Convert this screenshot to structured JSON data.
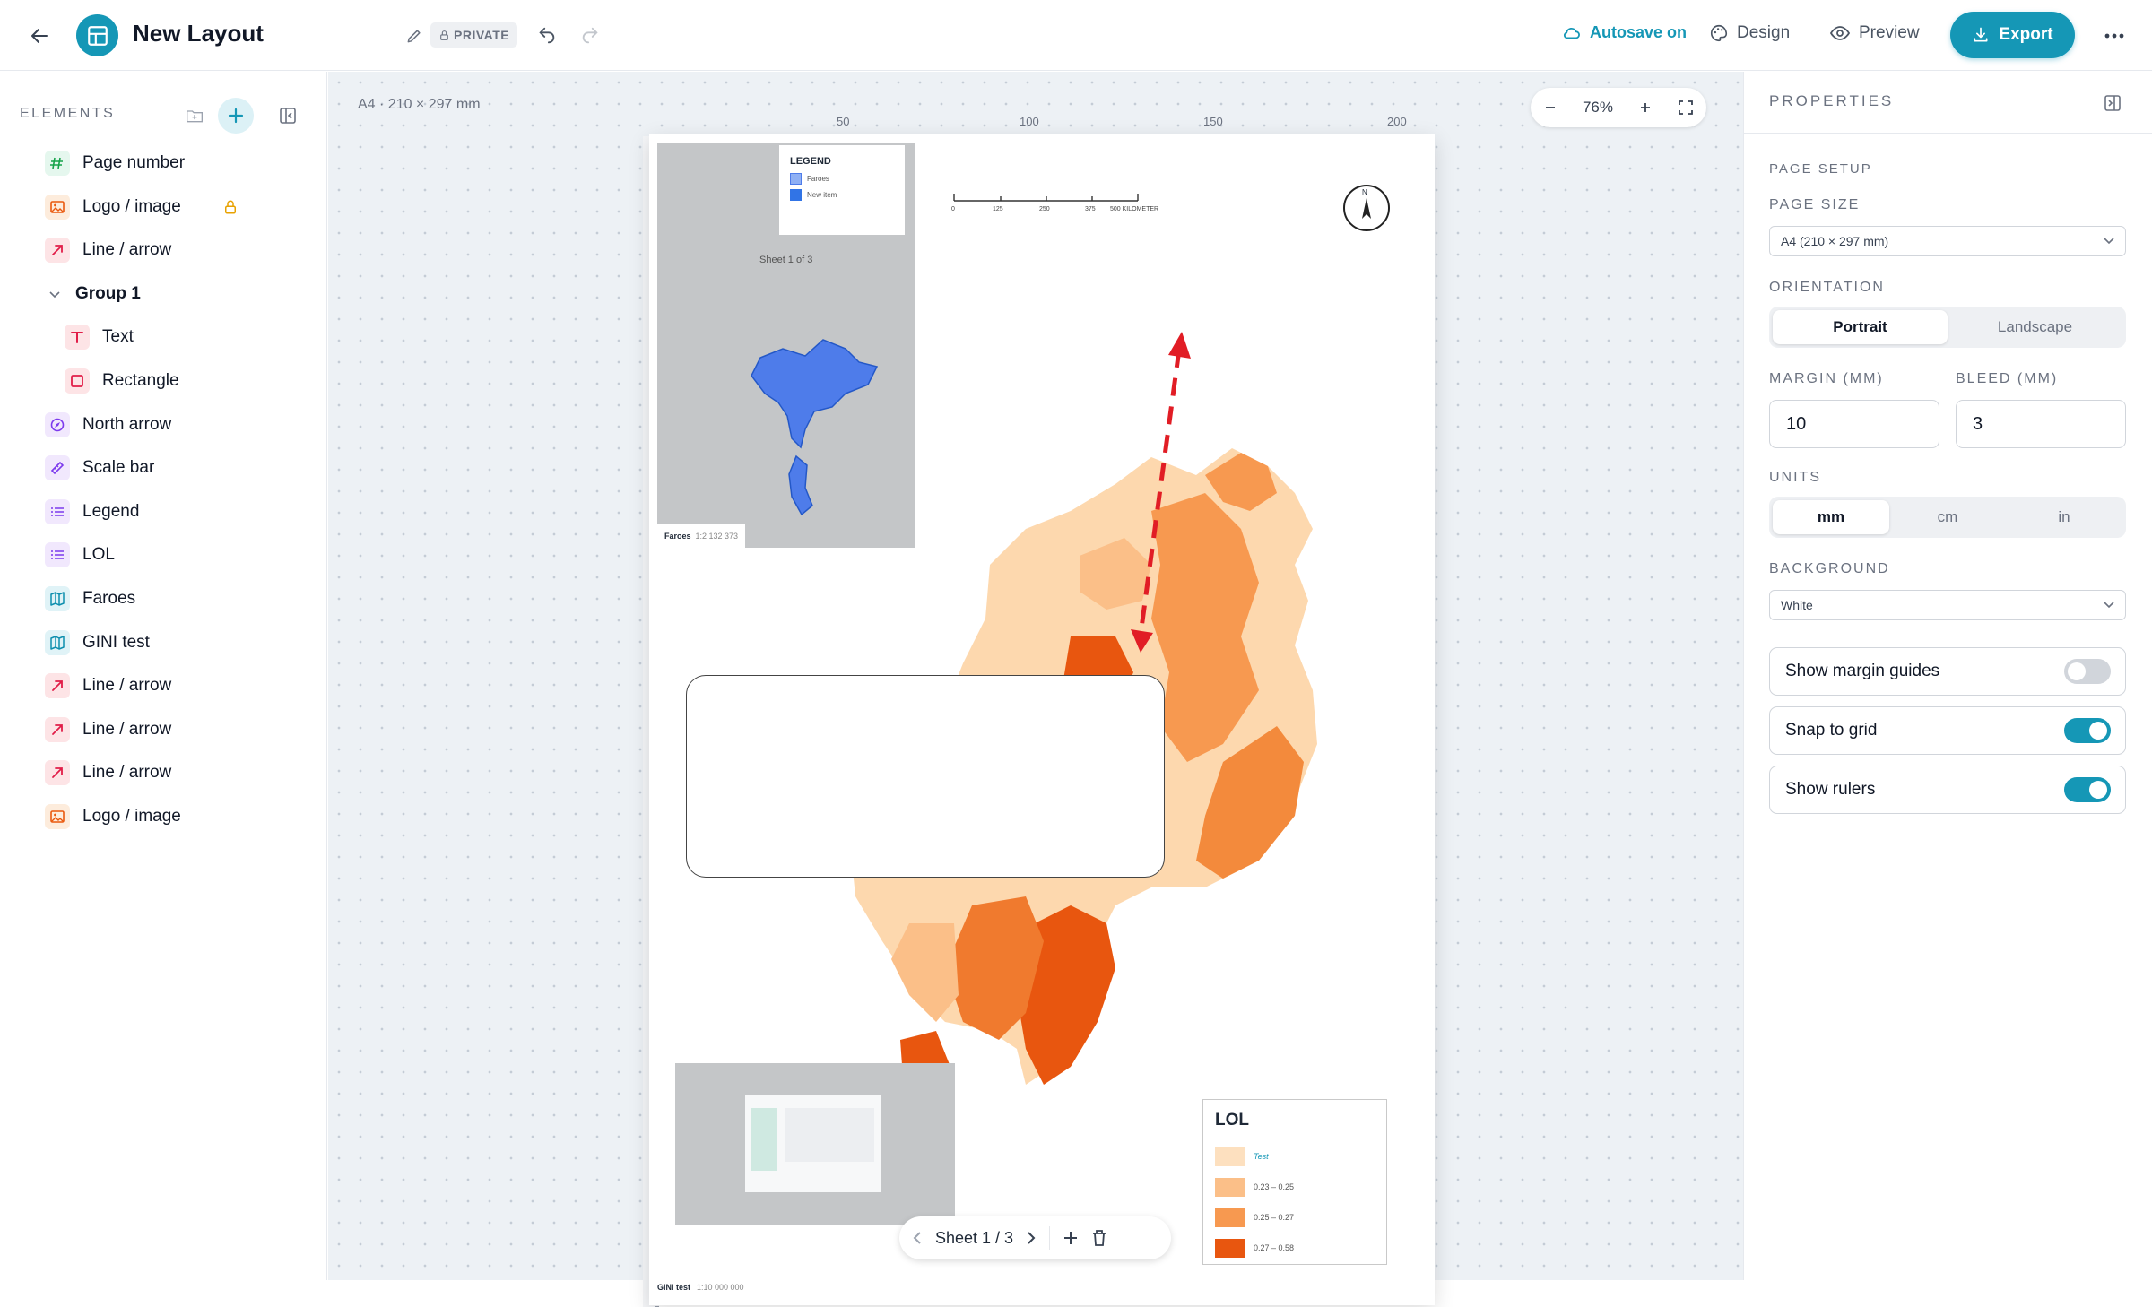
{
  "header": {
    "title": "New Layout",
    "private_label": "PRIVATE",
    "autosave_label": "Autosave on",
    "design_label": "Design",
    "preview_label": "Preview",
    "export_label": "Export",
    "accent": "#1597b6"
  },
  "sidebar": {
    "heading": "ELEMENTS",
    "items": [
      {
        "label": "Page number",
        "icon": "hash-icon"
      },
      {
        "label": "Logo / image",
        "icon": "image-icon",
        "locked": true
      },
      {
        "label": "Line / arrow",
        "icon": "arrow-icon"
      },
      {
        "label": "Group 1",
        "icon": "chevron-down-icon",
        "group": true
      },
      {
        "label": "Text",
        "icon": "text-icon",
        "child": true
      },
      {
        "label": "Rectangle",
        "icon": "square-icon",
        "child": true
      },
      {
        "label": "North arrow",
        "icon": "compass-icon"
      },
      {
        "label": "Scale bar",
        "icon": "ruler-icon"
      },
      {
        "label": "Legend",
        "icon": "list-icon"
      },
      {
        "label": "LOL",
        "icon": "list-icon"
      },
      {
        "label": "Faroes",
        "icon": "map-icon"
      },
      {
        "label": "GINI test",
        "icon": "map-icon"
      },
      {
        "label": "Line / arrow",
        "icon": "arrow-icon"
      },
      {
        "label": "Line / arrow",
        "icon": "arrow-icon"
      },
      {
        "label": "Line / arrow",
        "icon": "arrow-icon"
      },
      {
        "label": "Logo / image",
        "icon": "image-icon"
      }
    ]
  },
  "canvas": {
    "page_size_label": "A4 · 210 × 297 mm",
    "zoom": "76%",
    "ruler_labels": [
      "50",
      "100",
      "150",
      "200"
    ],
    "sheet_label": "Sheet 1 / 3"
  },
  "map_page": {
    "inset_legend_title": "LEGEND",
    "inset_legend_items": [
      "Faroes",
      "New item"
    ],
    "inset_sheet": "Sheet 1 of 3",
    "inset_caption": "Faroes",
    "inset_scale": "1:2 132 373",
    "scalebar_ticks": [
      "0",
      "125",
      "250",
      "375",
      "500 KILOMETER"
    ],
    "north_label": "N",
    "lol_title": "LOL",
    "lol_items": [
      {
        "label": "Test",
        "color": "#fde0bf"
      },
      {
        "label": "0.23 – 0.25",
        "color": "#fbbf88"
      },
      {
        "label": "0.25 – 0.27",
        "color": "#f79950"
      },
      {
        "label": "0.27 – 0.58",
        "color": "#e8560f"
      }
    ],
    "gini_caption": "GINI test",
    "gini_scale": "1:10 000 000"
  },
  "properties": {
    "heading": "PROPERTIES",
    "page_setup": "PAGE SETUP",
    "page_size_label": "PAGE SIZE",
    "page_size_value": "A4 (210 × 297 mm)",
    "orientation_label": "ORIENTATION",
    "orientation_options": [
      "Portrait",
      "Landscape"
    ],
    "margin_label": "MARGIN (MM)",
    "margin_value": "10",
    "bleed_label": "BLEED (MM)",
    "bleed_value": "3",
    "units_label": "UNITS",
    "units_options": [
      "mm",
      "cm",
      "in"
    ],
    "background_label": "BACKGROUND",
    "background_value": "White",
    "toggles": [
      {
        "label": "Show margin guides",
        "on": false
      },
      {
        "label": "Snap to grid",
        "on": true
      },
      {
        "label": "Show rulers",
        "on": true
      }
    ]
  }
}
